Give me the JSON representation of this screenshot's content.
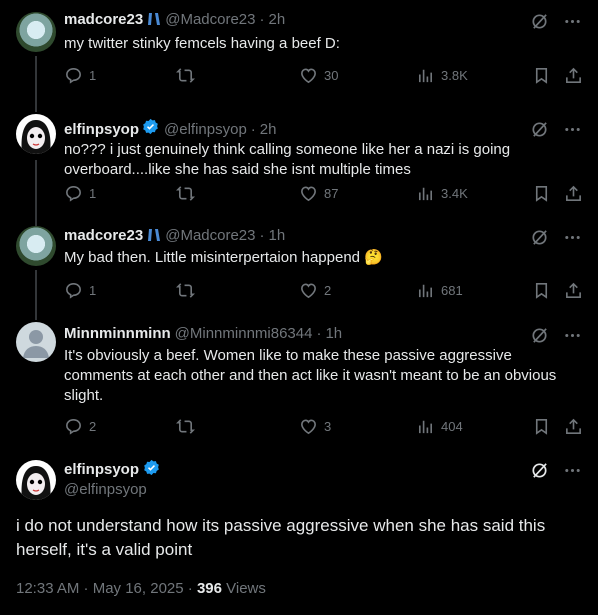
{
  "replies": [
    {
      "name": "madcore23",
      "handle": "@Madcore23",
      "time": "2h",
      "verified": false,
      "text": "my twitter stinky femcels having a beef D:",
      "replies": "1",
      "likes": "30",
      "views": "3.8K"
    },
    {
      "name": "elfinpsyop",
      "handle": "@elfinpsyop",
      "time": "2h",
      "verified": true,
      "text": "no??? i just genuinely think calling someone like her a nazi is going overboard....like she has said she isnt multiple times",
      "replies": "1",
      "likes": "87",
      "views": "3.4K"
    },
    {
      "name": "madcore23",
      "handle": "@Madcore23",
      "time": "1h",
      "verified": false,
      "text": "My bad then. Little misinterpertaion happend 🤔",
      "replies": "1",
      "likes": "2",
      "views": "681"
    },
    {
      "name": "Minnminnminn",
      "handle": "@Minnminnmi86344",
      "time": "1h",
      "verified": false,
      "text": "It's obviously a beef. Women like to make these passive aggressive comments at each other and then act like it wasn't meant to be an obvious slight.",
      "replies": "2",
      "likes": "3",
      "views": "404"
    }
  ],
  "main": {
    "name": "elfinpsyop",
    "handle": "@elfinpsyop",
    "text": "i do not understand how its passive aggressive when she has said this herself, it's a valid point",
    "timestamp": "12:33 AM · May 16, 2025 · ",
    "views_count": "396",
    "views_label": " Views"
  },
  "colors": {
    "background": "#000000",
    "text": "#e7e9ea",
    "muted": "#71767b",
    "verified": "#1d9bf0",
    "thread": "#333639"
  }
}
